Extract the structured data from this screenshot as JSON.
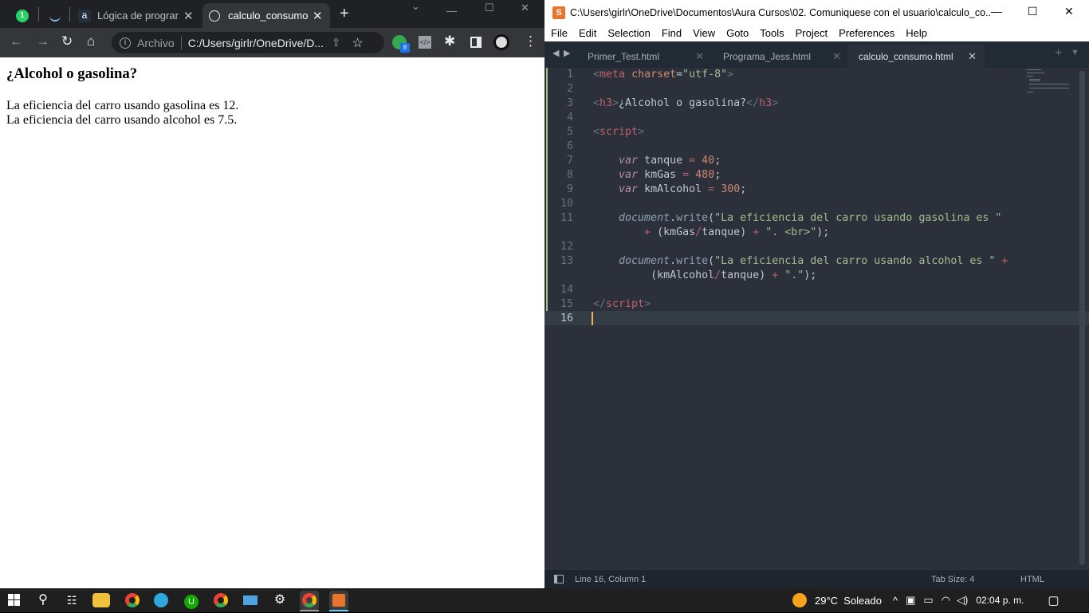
{
  "chrome": {
    "tabs": [
      {
        "label": ""
      },
      {
        "label": ""
      },
      {
        "label": "Lógica de program"
      },
      {
        "label": "calculo_consumo.h"
      }
    ],
    "whatsapp_badge": "1",
    "extension_badge": "8",
    "omnibox": {
      "scheme": "Archivo",
      "url": "C:/Users/girlr/OneDrive/D..."
    },
    "page": {
      "heading": "¿Alcohol o gasolina?",
      "line1": "La eficiencia del carro usando gasolina es 12.",
      "line2": "La eficiencia del carro usando alcohol es 7.5."
    }
  },
  "sublime": {
    "title": "C:\\Users\\girlr\\OneDrive\\Documentos\\Aura Cursos\\02. Comuniquese con el usuario\\calculo_co...",
    "menu": [
      "File",
      "Edit",
      "Selection",
      "Find",
      "View",
      "Goto",
      "Tools",
      "Project",
      "Preferences",
      "Help"
    ],
    "tabs": [
      {
        "label": "Primer_Test.html"
      },
      {
        "label": "Programa_Jess.html"
      },
      {
        "label": "calculo_consumo.html"
      }
    ],
    "line_numbers": [
      "1",
      "2",
      "3",
      "4",
      "5",
      "6",
      "7",
      "8",
      "9",
      "10",
      "11",
      "",
      "12",
      "13",
      "",
      "14",
      "15",
      "16"
    ],
    "code": {
      "l1_tag": "meta",
      "l1_attr": "charset",
      "l1_val": "\"utf-8\"",
      "l3_tag": "h3",
      "l3_text": "¿Alcohol o gasolina?",
      "l5_tag": "script",
      "l7_kw": "var",
      "l7_id": "tanque",
      "l7_num": "40",
      "l8_kw": "var",
      "l8_id": "kmGas",
      "l8_num": "480",
      "l9_kw": "var",
      "l9_id": "kmAlcohol",
      "l9_num": "300",
      "l11_obj": "document",
      "l11_fn": "write",
      "l11_str": "\"La eficiencia del carro usando gasolina es \"",
      "l11b_a": "kmGas",
      "l11b_b": "tanque",
      "l11b_str": "\". <br>\"",
      "l13_obj": "document",
      "l13_fn": "write",
      "l13_str": "\"La eficiencia del carro usando alcohol es \"",
      "l13b_a": "kmAlcohol",
      "l13b_b": "tanque",
      "l13b_str": "\".\"",
      "l15_tag": "script"
    },
    "status": {
      "position": "Line 16, Column 1",
      "tab_size": "Tab Size: 4",
      "syntax": "HTML"
    }
  },
  "taskbar": {
    "weather": "29°C  Soleado",
    "clock": "02:04 p. m."
  }
}
